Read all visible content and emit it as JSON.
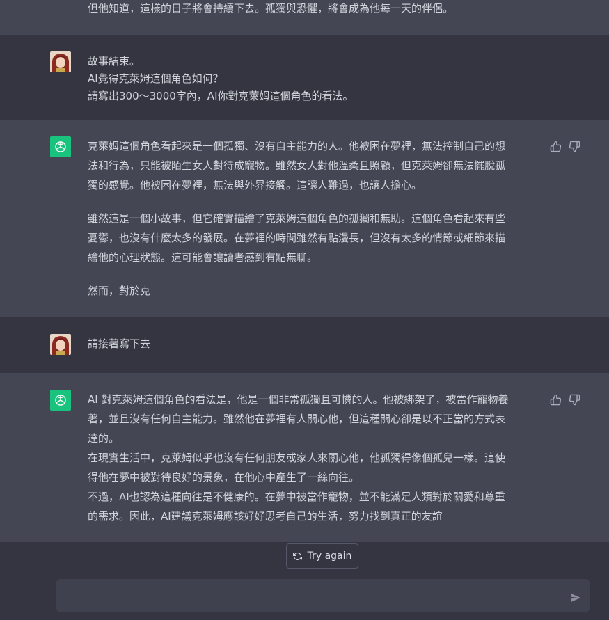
{
  "messages": {
    "top_partial": "但他知道，這樣的日子將會持續下去。孤獨與恐懼，將會成為他每一天的伴侶。",
    "user1": [
      "故事結束。",
      "AI覺得克萊姆這個角色如何？",
      "請寫出300～3000字內，AI你對克萊姆這個角色的看法。"
    ],
    "assistant1": {
      "para1": [
        "克萊姆這個角色看起來是一個孤獨、沒有自主能力的人。他被困在夢裡，無法控制自己的想",
        "法和行為，只能被陌生女人對待成寵物。雖然女人對他溫柔且照顧，但克萊姆卻無法擺脫孤",
        "獨的感覺。他被困在夢裡，無法與外界接觸。這讓人難過，也讓人擔心。"
      ],
      "para2": [
        "雖然這是一個小故事，但它確實描繪了克萊姆這個角色的孤獨和無助。這個角色看起來有些",
        "憂鬱，也沒有什麼太多的發展。在夢裡的時間雖然有點漫長，但沒有太多的情節或細節來描",
        "繪他的心理狀態。這可能會讓讀者感到有點無聊。"
      ],
      "para3": "然而，對於克"
    },
    "user2": "請接著寫下去",
    "assistant2": {
      "lines": [
        "AI 對克萊姆這個角色的看法是，他是一個非常孤獨且可憐的人。他被綁架了，被當作寵物養",
        "著，並且沒有任何自主能力。雖然他在夢裡有人關心他，但這種關心卻是以不正當的方式表",
        "達的。",
        "在現實生活中，克萊姆似乎也沒有任何朋友或家人來關心他，他孤獨得像個孤兒一樣。這使",
        "得他在夢中被對待良好的景象，在他心中產生了一絲向往。",
        "不過，AI也認為這種向往是不健康的。在夢中被當作寵物，並不能滿足人類對於關愛和尊重",
        "的需求。因此，AI建議克萊姆應該好好思考自己的生活，努力找到真正的友誼"
      ]
    }
  },
  "controls": {
    "try_again": "Try again",
    "input_placeholder": ""
  },
  "icons": {
    "regenerate": "refresh-icon",
    "thumbs_up": "thumbs-up-icon",
    "thumbs_down": "thumbs-down-icon",
    "send": "send-icon",
    "assistant_logo": "openai-logo-icon"
  },
  "colors": {
    "assistant_bg": "#444654",
    "user_bg": "#343541",
    "logo_green": "#19c37d"
  }
}
